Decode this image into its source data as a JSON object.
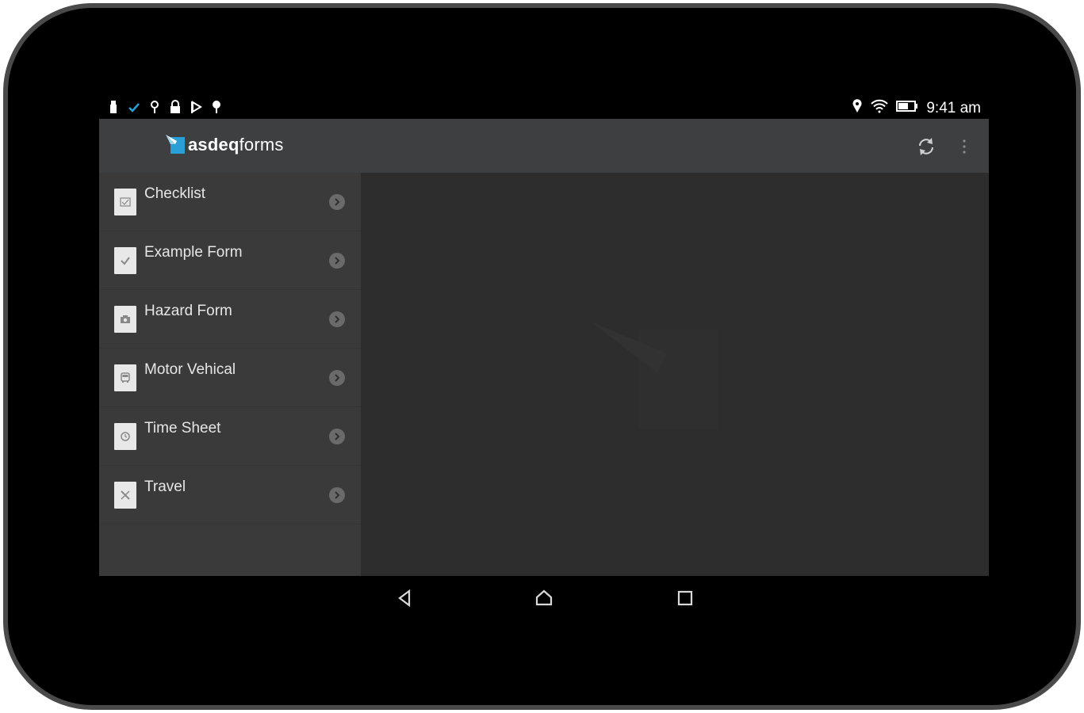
{
  "status_bar": {
    "time": "9:41 am",
    "left_icons": [
      "usb-icon",
      "check-icon",
      "key-icon",
      "lock-icon",
      "play-store-icon",
      "pin-icon"
    ],
    "right_icons": [
      "location-icon",
      "wifi-icon",
      "battery-icon"
    ]
  },
  "action_bar": {
    "app_name_bold": "asdeq",
    "app_name_rest": "forms",
    "actions": [
      "refresh-icon",
      "overflow-menu-icon"
    ]
  },
  "forms": [
    {
      "label": "Checklist",
      "icon": "checklist-icon"
    },
    {
      "label": "Example Form",
      "icon": "checkmark-icon"
    },
    {
      "label": "Hazard Form",
      "icon": "camera-icon"
    },
    {
      "label": "Motor Vehical",
      "icon": "car-icon"
    },
    {
      "label": "Time Sheet",
      "icon": "clock-icon"
    },
    {
      "label": "Travel",
      "icon": "plane-icon"
    }
  ],
  "nav_bar": {
    "buttons": [
      "back-icon",
      "home-icon",
      "recents-icon"
    ]
  },
  "colors": {
    "accent": "#2a9fd6",
    "action_bar": "#3e3f40",
    "sidebar": "#3a3a3a",
    "content": "#2d2d2d"
  }
}
